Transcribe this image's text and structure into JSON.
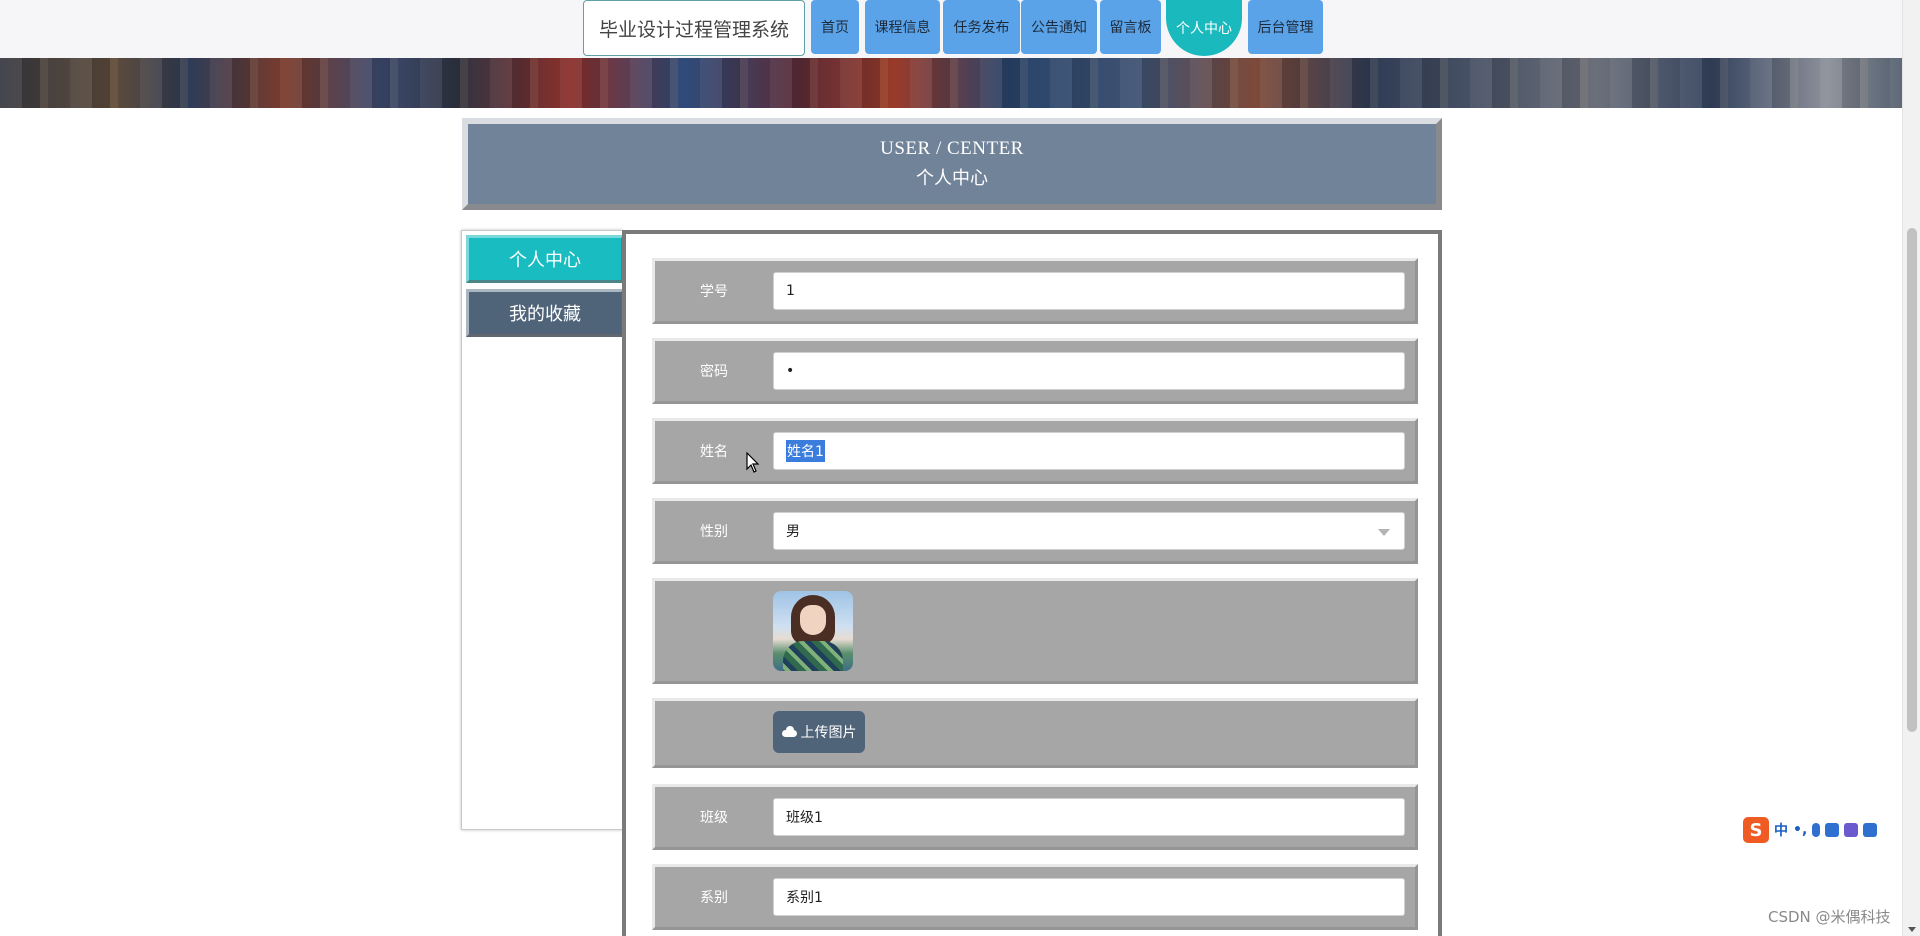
{
  "site": {
    "title": "毕业设计过程管理系统"
  },
  "nav": {
    "items": [
      {
        "label": "首页",
        "active": false
      },
      {
        "label": "课程信息",
        "active": false
      },
      {
        "label": "任务发布",
        "active": false
      },
      {
        "label": "公告通知",
        "active": false
      },
      {
        "label": "留言板",
        "active": false
      },
      {
        "label": "个人中心",
        "active": true
      },
      {
        "label": "后台管理",
        "active": false
      }
    ]
  },
  "header": {
    "en": "USER / CENTER",
    "zh": "个人中心"
  },
  "side": {
    "items": [
      {
        "label": "个人中心",
        "active": true
      },
      {
        "label": "我的收藏",
        "active": false
      }
    ]
  },
  "form": {
    "student_id": {
      "label": "学号",
      "value": "1"
    },
    "password": {
      "label": "密码",
      "value": "•"
    },
    "name": {
      "label": "姓名",
      "value": "姓名1"
    },
    "gender": {
      "label": "性别",
      "value": "男"
    },
    "upload": {
      "label": "上传图片"
    },
    "class": {
      "label": "班级",
      "value": "班级1"
    },
    "department": {
      "label": "系别",
      "value": "系别1"
    }
  },
  "ime": {
    "logo": "S",
    "mode": "中",
    "punct": "•,"
  },
  "watermark": "CSDN @米偶科技",
  "colors": {
    "nav": "#5ba3e8",
    "active": "#19b9bd",
    "header": "#708399",
    "row": "#a6a6a6",
    "button": "#4f6379"
  }
}
